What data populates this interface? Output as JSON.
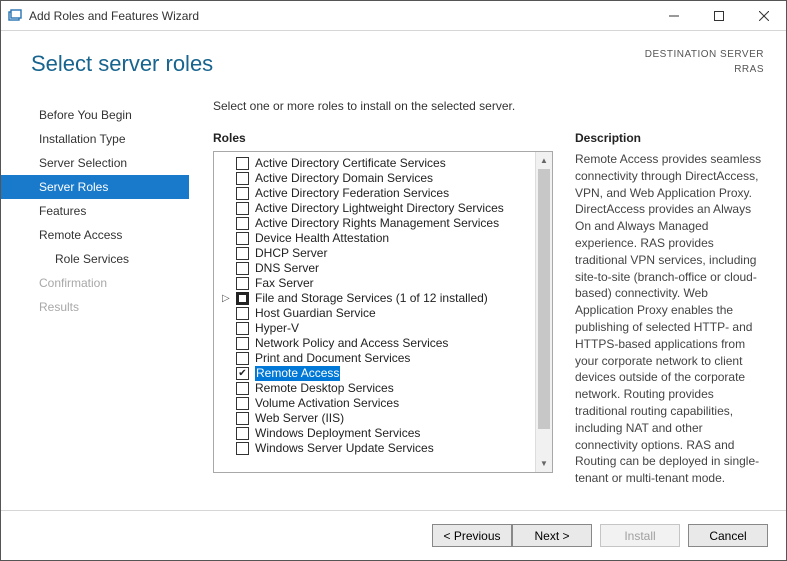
{
  "window": {
    "title": "Add Roles and Features Wizard"
  },
  "header": {
    "heading": "Select server roles",
    "dest_label": "DESTINATION SERVER",
    "dest_value": "RRAS"
  },
  "nav": [
    {
      "label": "Before You Begin",
      "state": "normal"
    },
    {
      "label": "Installation Type",
      "state": "normal"
    },
    {
      "label": "Server Selection",
      "state": "normal"
    },
    {
      "label": "Server Roles",
      "state": "active"
    },
    {
      "label": "Features",
      "state": "normal"
    },
    {
      "label": "Remote Access",
      "state": "normal"
    },
    {
      "label": "Role Services",
      "state": "normal",
      "sub": true
    },
    {
      "label": "Confirmation",
      "state": "disabled"
    },
    {
      "label": "Results",
      "state": "disabled"
    }
  ],
  "instruction": "Select one or more roles to install on the selected server.",
  "roles_label": "Roles",
  "roles": [
    {
      "label": "Active Directory Certificate Services",
      "checked": false
    },
    {
      "label": "Active Directory Domain Services",
      "checked": false
    },
    {
      "label": "Active Directory Federation Services",
      "checked": false
    },
    {
      "label": "Active Directory Lightweight Directory Services",
      "checked": false
    },
    {
      "label": "Active Directory Rights Management Services",
      "checked": false
    },
    {
      "label": "Device Health Attestation",
      "checked": false
    },
    {
      "label": "DHCP Server",
      "checked": false
    },
    {
      "label": "DNS Server",
      "checked": false
    },
    {
      "label": "Fax Server",
      "checked": false
    },
    {
      "label": "File and Storage Services (1 of 12 installed)",
      "checked": "indeterminate",
      "expandable": true
    },
    {
      "label": "Host Guardian Service",
      "checked": false
    },
    {
      "label": "Hyper-V",
      "checked": false
    },
    {
      "label": "Network Policy and Access Services",
      "checked": false
    },
    {
      "label": "Print and Document Services",
      "checked": false
    },
    {
      "label": "Remote Access",
      "checked": true,
      "selected": true
    },
    {
      "label": "Remote Desktop Services",
      "checked": false
    },
    {
      "label": "Volume Activation Services",
      "checked": false
    },
    {
      "label": "Web Server (IIS)",
      "checked": false
    },
    {
      "label": "Windows Deployment Services",
      "checked": false
    },
    {
      "label": "Windows Server Update Services",
      "checked": false
    }
  ],
  "description_label": "Description",
  "description_text": "Remote Access provides seamless connectivity through DirectAccess, VPN, and Web Application Proxy. DirectAccess provides an Always On and Always Managed experience. RAS provides traditional VPN services, including site-to-site (branch-office or cloud-based) connectivity. Web Application Proxy enables the publishing of selected HTTP- and HTTPS-based applications from your corporate network to client devices outside of the corporate network. Routing provides traditional routing capabilities, including NAT and other connectivity options. RAS and Routing can be deployed in single-tenant or multi-tenant mode.",
  "footer": {
    "previous": "< Previous",
    "next": "Next >",
    "install": "Install",
    "cancel": "Cancel"
  }
}
